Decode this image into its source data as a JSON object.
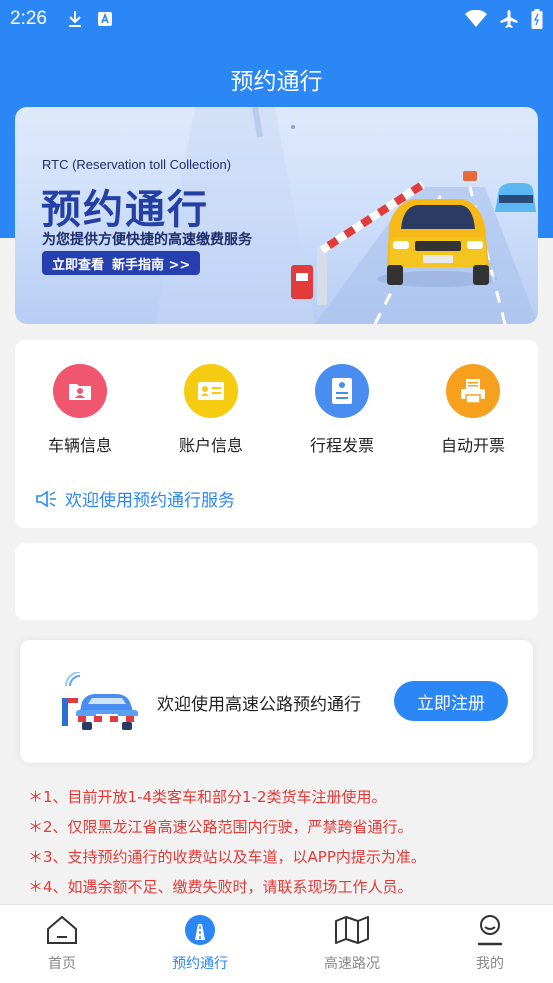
{
  "status_bar": {
    "time": "2:26",
    "icons": [
      "download-icon",
      "a-icon",
      "wifi-icon",
      "airplane-icon",
      "battery-icon"
    ]
  },
  "page": {
    "title": "预约通行"
  },
  "banner": {
    "subtitle": "RTC (Reservation toll Collection)",
    "title": "预约通行",
    "tagline": "为您提供方便快捷的高速缴费服务",
    "button_label": "立即查看",
    "guide_label": "新手指南 >>"
  },
  "menu": {
    "items": [
      {
        "label": "车辆信息",
        "icon": "vehicle-info-icon",
        "color": "#f0566e"
      },
      {
        "label": "账户信息",
        "icon": "account-info-icon",
        "color": "#f5cc12"
      },
      {
        "label": "行程发票",
        "icon": "trip-invoice-icon",
        "color": "#4a8df0"
      },
      {
        "label": "自动开票",
        "icon": "auto-invoice-icon",
        "color": "#f7a01e"
      }
    ],
    "notice": "欢迎使用预约通行服务"
  },
  "register": {
    "text": "欢迎使用高速公路预约通行",
    "button_label": "立即注册"
  },
  "rules": [
    "＊1、目前开放1-4类客车和部分1-2类货车注册使用。",
    "＊2、仅限黑龙江省高速公路范围内行驶，严禁跨省通行。",
    "＊3、支持预约通行的收费站以及车道，以APP内提示为准。",
    "＊4、如遇余额不足、缴费失败时，请联系现场工作人员。"
  ],
  "tabbar": {
    "tabs": [
      {
        "label": "首页",
        "icon": "home-icon",
        "active": false
      },
      {
        "label": "预约通行",
        "icon": "reservation-icon",
        "active": true
      },
      {
        "label": "高速路况",
        "icon": "map-icon",
        "active": false
      },
      {
        "label": "我的",
        "icon": "profile-icon",
        "active": false
      }
    ]
  },
  "colors": {
    "primary": "#2b86f6",
    "warning": "#e53935",
    "background": "#f2f2f2"
  }
}
